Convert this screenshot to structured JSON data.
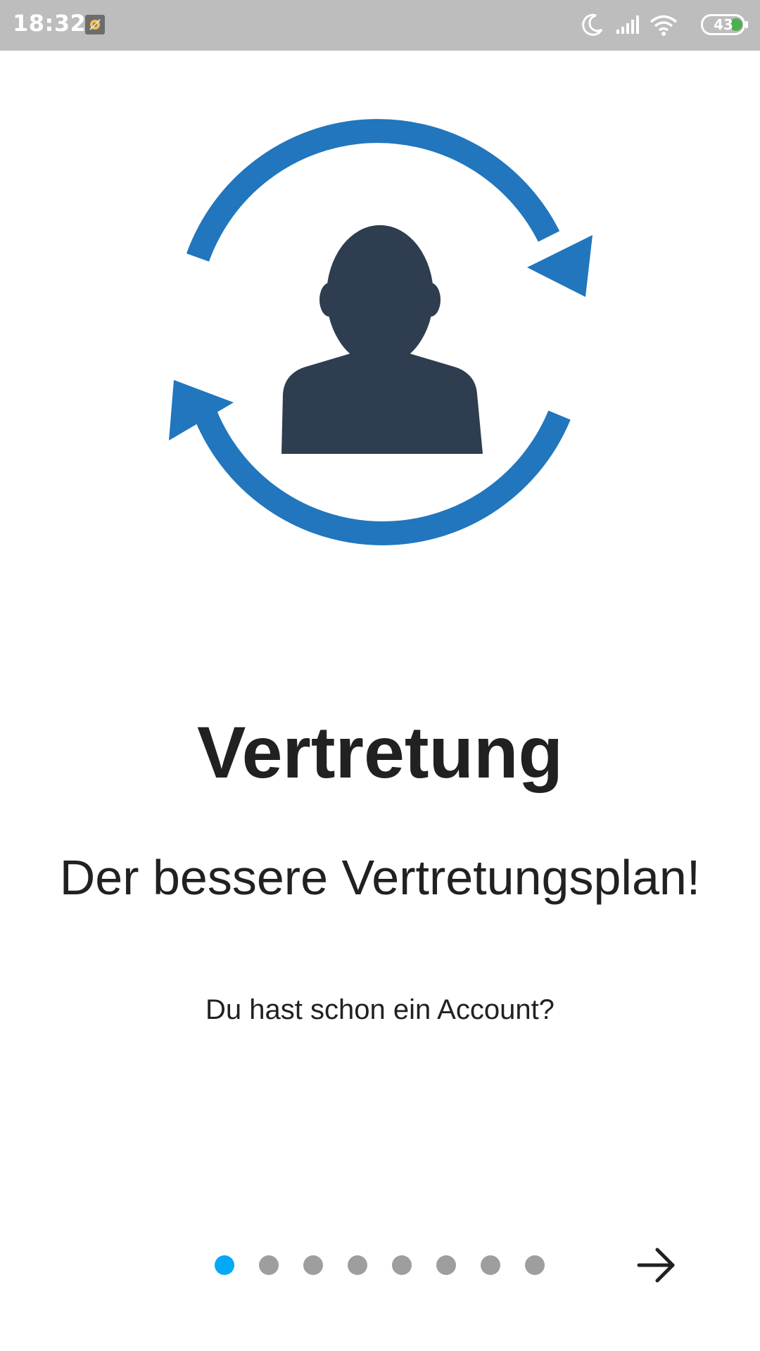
{
  "status_bar": {
    "time": "18:32",
    "battery_level": "43",
    "icons": [
      "app-notification-icon",
      "moon-icon",
      "signal-icon",
      "wifi-icon",
      "battery-icon"
    ]
  },
  "illustration": {
    "icon": "person-sync-icon",
    "arrow_color": "#2176bd",
    "person_color": "#2e3d4f"
  },
  "onboarding": {
    "title": "Vertretung",
    "subtitle": "Der bessere Vertretungsplan!",
    "account_link": "Du hast schon ein Account?"
  },
  "pager": {
    "total_pages": 8,
    "current_page": 1,
    "active_color": "#03a9f4",
    "inactive_color": "#9e9e9e",
    "next_icon": "arrow-right-icon"
  }
}
